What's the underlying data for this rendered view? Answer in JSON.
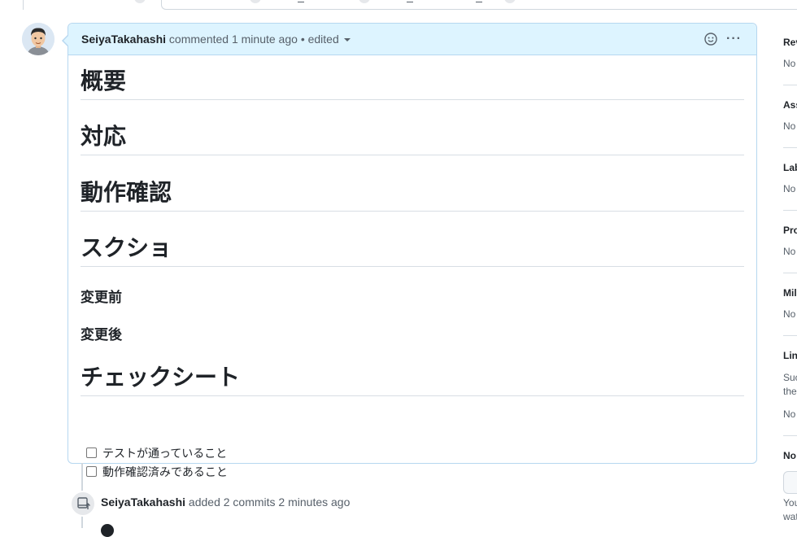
{
  "comment": {
    "author": "SeiyaTakahashi",
    "action": "commented",
    "time": "1 minute ago",
    "separator": "•",
    "edited": "edited",
    "more": "···",
    "headings": [
      "概要",
      "対応",
      "動作確認",
      "スクショ"
    ],
    "sub_headings": [
      "変更前",
      "変更後"
    ],
    "checklist_heading": "チェックシート",
    "tasks": [
      {
        "label": "テストが通っていること",
        "checked": false
      },
      {
        "label": "動作確認済みであること",
        "checked": false
      }
    ]
  },
  "timeline": {
    "author": "SeiyaTakahashi",
    "action": "added 2 commits",
    "time": "2 minutes ago"
  },
  "sidebar": {
    "sections": [
      {
        "title": "Rev",
        "value": "No"
      },
      {
        "title": "Ass",
        "value": "No"
      },
      {
        "title": "Lab",
        "value": "No"
      },
      {
        "title": "Pro",
        "value": "No"
      },
      {
        "title": "Mil",
        "value": "No"
      },
      {
        "title": "Lin",
        "lines": [
          "Suc",
          "the"
        ],
        "value": "No"
      },
      {
        "title": "No",
        "lines": [
          "You",
          "wat"
        ]
      }
    ]
  },
  "colors": {
    "header_bg": "#ddf4ff",
    "header_border": "#b6d7f0",
    "text": "#1f2328",
    "muted": "#57606a"
  }
}
